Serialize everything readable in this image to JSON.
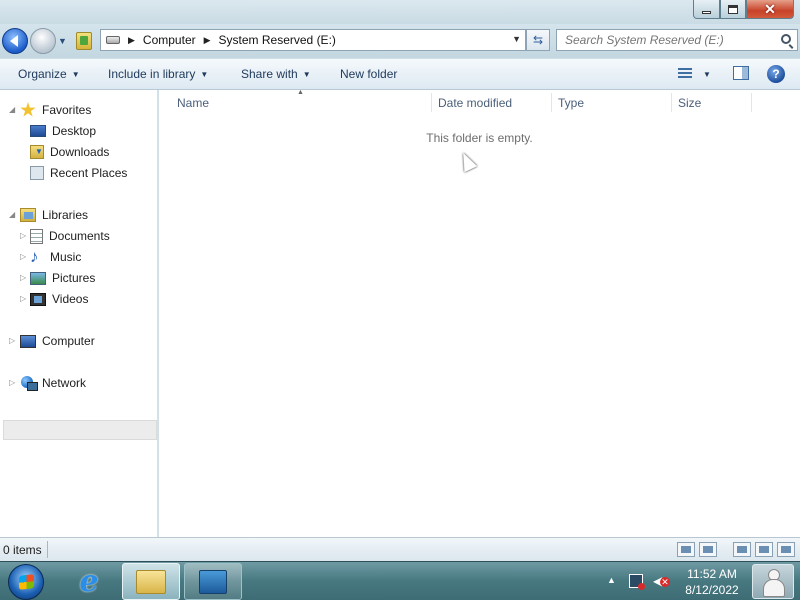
{
  "window": {
    "title_buttons": {
      "minimize_icon": "minimize-icon",
      "maximize_icon": "maximize-icon",
      "close_icon": "close-icon"
    }
  },
  "navigation": {
    "address": {
      "crumbs": [
        "Computer",
        "System Reserved (E:)"
      ]
    },
    "search": {
      "placeholder": "Search System Reserved (E:)",
      "value": ""
    }
  },
  "commandbar": {
    "organize": "Organize",
    "include_in_library": "Include in library",
    "share_with": "Share with",
    "new_folder": "New folder"
  },
  "navpane": {
    "favorites": {
      "label": "Favorites",
      "items": [
        "Desktop",
        "Downloads",
        "Recent Places"
      ]
    },
    "libraries": {
      "label": "Libraries",
      "items": [
        "Documents",
        "Music",
        "Pictures",
        "Videos"
      ]
    },
    "computer": {
      "label": "Computer",
      "selected": true
    },
    "network": {
      "label": "Network"
    }
  },
  "content": {
    "columns": [
      "Name",
      "Date modified",
      "Type",
      "Size"
    ],
    "empty_message": "This folder is empty."
  },
  "statusbar": {
    "item_count": "0 items"
  },
  "taskbar": {
    "apps": [
      "internet-explorer-icon",
      "windows-explorer-icon",
      "control-panel-icon"
    ],
    "clock": {
      "time": "11:52 AM",
      "date": "8/12/2022"
    }
  },
  "colors": {
    "accent": "#1e395b",
    "window_frame": "#cfe0e8",
    "taskbar": "#477880"
  }
}
